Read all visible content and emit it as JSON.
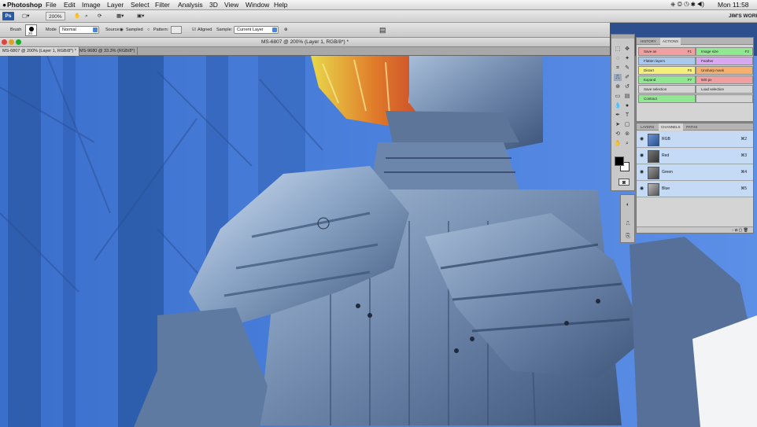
{
  "menubar": {
    "items": [
      "Photoshop",
      "File",
      "Edit",
      "Image",
      "Layer",
      "Select",
      "Filter",
      "Analysis",
      "3D",
      "View",
      "Window",
      "Help"
    ],
    "clock": "Mon 11:58",
    "workspace": "JIM'S WORK"
  },
  "appbar": {
    "zoom": "200%"
  },
  "options": {
    "brush_label": "Brush",
    "brush_size": "20",
    "mode_label": "Mode",
    "mode_value": "Normal",
    "source_label": "Source:",
    "sampled_label": "Sampled",
    "pattern_label": "Pattern:",
    "aligned_label": "Aligned",
    "sample_label": "Sample:",
    "sample_value": "Current Layer"
  },
  "document": {
    "title": "MS-6807 @ 200% (Layer 1, RGB/8*) *",
    "tabs": [
      "MS-6807 @ 200% (Layer 1, RGB/8*) *",
      "MS-9680 @ 33.3% (RGB/8*)"
    ]
  },
  "actions_panel": {
    "tabs": [
      "HISTORY",
      "ACTIONS"
    ],
    "actions": [
      {
        "label": "Save as",
        "key": "F1",
        "color": "#f0a0a0"
      },
      {
        "label": "Image size",
        "key": "F2",
        "color": "#90e890"
      },
      {
        "label": "Flatten layers",
        "key": "",
        "color": "#a8c8ee"
      },
      {
        "label": "Feather",
        "key": "",
        "color": "#d8a8f0"
      },
      {
        "label": "Distort",
        "key": "F5",
        "color": "#f5f07a"
      },
      {
        "label": "Unsharp mask",
        "key": "",
        "color": "#f5b070"
      },
      {
        "label": "Expand",
        "key": "F7",
        "color": "#90e890"
      },
      {
        "label": "500 px",
        "key": "",
        "color": "#f0a0a0"
      },
      {
        "label": "Save selection",
        "key": "",
        "color": "#d4d4d4"
      },
      {
        "label": "Load selection",
        "key": "",
        "color": "#d4d4d4"
      },
      {
        "label": "Contract",
        "key": "",
        "color": "#90e890"
      },
      {
        "label": "",
        "key": "",
        "color": "#d4d4d4"
      }
    ]
  },
  "channels_panel": {
    "tabs": [
      "LAYERS",
      "CHANNELS",
      "PATHS"
    ],
    "channels": [
      {
        "name": "RGB",
        "shortcut": "⌘2"
      },
      {
        "name": "Red",
        "shortcut": "⌘3"
      },
      {
        "name": "Green",
        "shortcut": "⌘4"
      },
      {
        "name": "Blue",
        "shortcut": "⌘5"
      }
    ]
  },
  "colors": {
    "canvas_bg": "#3d6fc4",
    "armor": "#7e97b8",
    "panel_selected": "#c5daf5"
  }
}
